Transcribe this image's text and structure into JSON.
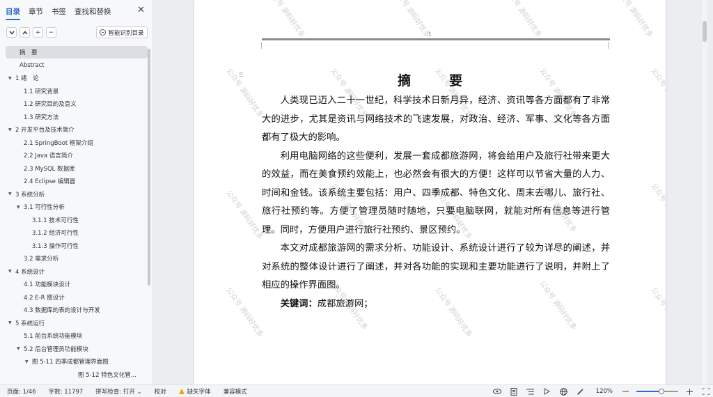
{
  "sidebar": {
    "tabs": [
      {
        "label": "目录",
        "active": true
      },
      {
        "label": "章节",
        "active": false
      },
      {
        "label": "书签",
        "active": false
      },
      {
        "label": "查找和替换",
        "active": false
      }
    ],
    "close_glyph": "✕",
    "toolbar": {
      "collapse_glyph": "⌄",
      "expand_glyph": "⌃",
      "add_glyph": "+",
      "remove_glyph": "−",
      "smart_label": "智能识别目录"
    },
    "toc": [
      {
        "label": "摘　要",
        "level": 0,
        "selected": true,
        "caret": false
      },
      {
        "label": "Abstract",
        "level": 0,
        "caret": false
      },
      {
        "label": "1  绪　论",
        "level": 0,
        "caret": true
      },
      {
        "label": "1.1 研究背景",
        "level": 1,
        "caret": false
      },
      {
        "label": "1.2 研究目的及意义",
        "level": 1,
        "caret": false
      },
      {
        "label": "1.3 研究方法",
        "level": 1,
        "caret": false
      },
      {
        "label": "2  开发平台及技术简介",
        "level": 0,
        "caret": true
      },
      {
        "label": "2.1 SpringBoot 框架介绍",
        "level": 1,
        "caret": false
      },
      {
        "label": "2.2 Java 语言简介",
        "level": 1,
        "caret": false
      },
      {
        "label": "2.3 MySQL 数据库",
        "level": 1,
        "caret": false
      },
      {
        "label": "2.4 Eclipse  编辑器",
        "level": 1,
        "caret": false
      },
      {
        "label": "3  系统分析",
        "level": 0,
        "caret": true
      },
      {
        "label": "3.1 可行性分析",
        "level": 1,
        "caret": true
      },
      {
        "label": "3.1.1 技术可行性",
        "level": 2,
        "caret": false
      },
      {
        "label": "3.1.2 经济可行性",
        "level": 2,
        "caret": false
      },
      {
        "label": "3.1.3 操作可行性",
        "level": 2,
        "caret": false
      },
      {
        "label": "3.2 需求分析",
        "level": 1,
        "caret": false
      },
      {
        "label": "4  系统设计",
        "level": 0,
        "caret": true
      },
      {
        "label": "4.1 功能模块设计",
        "level": 1,
        "caret": false
      },
      {
        "label": "4.2 E-R 图设计",
        "level": 1,
        "caret": false
      },
      {
        "label": "4.3 数据库的表的设计与开发",
        "level": 1,
        "caret": false
      },
      {
        "label": "5 系统运行",
        "level": 0,
        "caret": true
      },
      {
        "label": "5.1 前台系统功能模块",
        "level": 1,
        "caret": false
      },
      {
        "label": "5.2 后台管理员功能模块",
        "level": 1,
        "caret": true
      },
      {
        "label": "图 5-11 四季成都管理界面图",
        "level": 2,
        "caret": true
      },
      {
        "label": "图 5-12 特色文化管...",
        "level": 4,
        "caret": false
      }
    ]
  },
  "document": {
    "page_number": "1",
    "title": "摘　要",
    "paragraphs": [
      "人类现已迈入二十一世纪，科学技术日新月异，经济、资讯等各方面都有了非常大的进步，尤其是资讯与网络技术的飞速发展，对政治、经济、军事、文化等各方面都有了极大的影响。",
      "利用电脑网络的这些便利，发展一套成都旅游网，将会给用户及旅行社带来更大的效益，而在美食预约效能上，也必然会有很大的方便！这样可以节省大量的人力、时间和金钱。该系统主要包括：用户、四季成都、特色文化、周末去哪儿、旅行社、旅行社预约等。方便了管理员随时随地，只要电脑联网，就能对所有信息等进行管理。同时，方便用户进行旅行社预约、景区预约。",
      "本文对成都旅游网的需求分析、功能设计、系统设计进行了较为详尽的阐述，并对系统的整体设计进行了阐述，并对各功能的实现和主要功能进行了说明，并附上了相应的操作界面图。"
    ],
    "keywords_label": "关键词：",
    "keywords_value": "成都旅游网；",
    "watermark": "公众号 源码好优多"
  },
  "statusbar": {
    "page": "页面: 1/46",
    "words": "字数: 11797",
    "spell": "拼写检查: 打开 ⌄",
    "proof": "校对",
    "missing_font": "缺失字体",
    "compat": "兼容模式",
    "zoom": "120%",
    "zoom_fraction": 0.6,
    "icons": [
      "eye-icon",
      "page-view-icon",
      "outline-icon",
      "play-icon",
      "web-icon",
      "pen-icon"
    ]
  }
}
